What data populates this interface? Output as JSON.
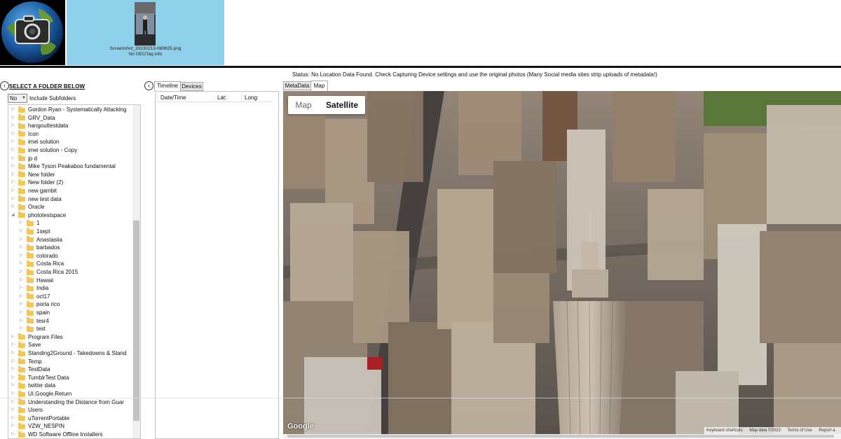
{
  "thumbnail": {
    "file_name": "Screenshot_20230213-080625.png",
    "geotag_info": "No GEOTag Info"
  },
  "status": {
    "text": "Status: No Location Data Found. Check Capturing Device settings and use the original photos (Many Social media sites strip uploads of metadata!)"
  },
  "sidebar": {
    "collapse_icon": "chevron-left-icon",
    "title": "SELECT A FOLDER BELOW",
    "subfolders_value": "No",
    "subfolders_label": "Include Subfolders",
    "tree": [
      {
        "label": "Gordon Ryan - Systematically Attacking",
        "level": 0
      },
      {
        "label": "GRV_Data",
        "level": 0
      },
      {
        "label": "hangouttestdata",
        "level": 0
      },
      {
        "label": "Icon",
        "level": 0
      },
      {
        "label": "imei solution",
        "level": 0
      },
      {
        "label": "imei solution - Copy",
        "level": 0
      },
      {
        "label": "jp d",
        "level": 0
      },
      {
        "label": "Mike Tyson Peakaboo fundamental",
        "level": 0
      },
      {
        "label": "New folder",
        "level": 0
      },
      {
        "label": "New folder (2)",
        "level": 0
      },
      {
        "label": "new gambit",
        "level": 0
      },
      {
        "label": "new test data",
        "level": 0
      },
      {
        "label": "Oracle",
        "level": 0
      },
      {
        "label": "phototestspace",
        "level": 0,
        "expanded": true
      },
      {
        "label": "1",
        "level": 1
      },
      {
        "label": "1sept",
        "level": 1
      },
      {
        "label": "Anastasiia",
        "level": 1
      },
      {
        "label": "barbados",
        "level": 1
      },
      {
        "label": "colorado",
        "level": 1
      },
      {
        "label": "Costa Rica",
        "level": 1
      },
      {
        "label": "Costa Rica 2015",
        "level": 1
      },
      {
        "label": "Hawaii",
        "level": 1
      },
      {
        "label": "India",
        "level": 1
      },
      {
        "label": "oct17",
        "level": 1
      },
      {
        "label": "porta rico",
        "level": 1
      },
      {
        "label": "spain",
        "level": 1
      },
      {
        "label": "tesr4",
        "level": 1
      },
      {
        "label": "test",
        "level": 1
      },
      {
        "label": "Program Files",
        "level": 0
      },
      {
        "label": "Save",
        "level": 0
      },
      {
        "label": "Standing2Ground - Takedowns & Stand",
        "level": 0
      },
      {
        "label": "Temp",
        "level": 0
      },
      {
        "label": "TestData",
        "level": 0
      },
      {
        "label": "TumblrTest Data",
        "level": 0
      },
      {
        "label": "twitter data",
        "level": 0
      },
      {
        "label": "UI.Google.Return",
        "level": 0
      },
      {
        "label": "Understanding the Distance from Guar",
        "level": 0
      },
      {
        "label": "Users",
        "level": 0
      },
      {
        "label": "uTorrentPortable",
        "level": 0
      },
      {
        "label": "VZW_NESPIN",
        "level": 0
      },
      {
        "label": "WD Software Offline Installers",
        "level": 0
      }
    ]
  },
  "middle": {
    "tabs": [
      "Timeline",
      "Devices"
    ],
    "columns": [
      "Date/Time",
      "Lat:",
      "Long:"
    ]
  },
  "map_panel": {
    "tabs": [
      "MetaData",
      "Map"
    ],
    "map_type": {
      "map": "Map",
      "satellite": "Satellite",
      "selected": "Satellite"
    },
    "google_logo": "Google",
    "attribution": [
      "Keyboard shortcuts",
      "Map data ©2023",
      "Terms of Use",
      "Report a"
    ]
  },
  "colors": {
    "thumbnail_bg": "#8ed0ea",
    "folder": "#f3c65a",
    "logo_bg": "#000000"
  }
}
